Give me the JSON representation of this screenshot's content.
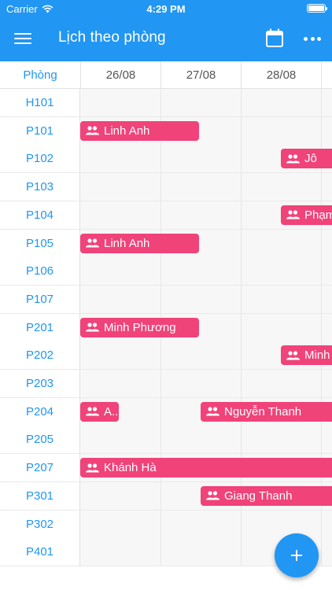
{
  "status_bar": {
    "carrier": "Carrier",
    "time": "4:29 PM"
  },
  "app_bar": {
    "title": "Lịch theo phòng",
    "menu_icon": "hamburger-icon",
    "calendar_icon": "calendar-icon",
    "more_icon": "more-horizontal-icon"
  },
  "table": {
    "room_header": "Phòng",
    "dates": [
      "26/08",
      "27/08",
      "28/08"
    ],
    "rows": [
      {
        "room": "H101",
        "events": []
      },
      {
        "room": "P101",
        "events": [
          {
            "name": "Linh Anh",
            "start_day": 0,
            "span": 1.5
          }
        ]
      },
      {
        "room": "P102",
        "events": [
          {
            "name": "Jô",
            "start_day": 2.5,
            "span": 1
          }
        ]
      },
      {
        "room": "P103",
        "events": []
      },
      {
        "room": "P104",
        "events": [
          {
            "name": "Phạm",
            "start_day": 2.5,
            "span": 1
          }
        ]
      },
      {
        "room": "P105",
        "events": [
          {
            "name": "Linh Anh",
            "start_day": 0,
            "span": 1.5
          }
        ]
      },
      {
        "room": "P106",
        "events": []
      },
      {
        "room": "P107",
        "events": []
      },
      {
        "room": "P201",
        "events": [
          {
            "name": "Minh Phương",
            "start_day": 0,
            "span": 1.5
          }
        ]
      },
      {
        "room": "P202",
        "events": [
          {
            "name": "Minh",
            "start_day": 2.5,
            "span": 1
          }
        ]
      },
      {
        "room": "P203",
        "events": []
      },
      {
        "room": "P204",
        "events": [
          {
            "name": "A...",
            "start_day": 0,
            "span": 0.5
          },
          {
            "name": "Nguyễn Thanh",
            "start_day": 1.5,
            "span": 2
          }
        ]
      },
      {
        "room": "P205",
        "events": []
      },
      {
        "room": "P207",
        "events": [
          {
            "name": "Khánh Hà",
            "start_day": 0,
            "span": 3.5
          }
        ]
      },
      {
        "room": "P301",
        "events": [
          {
            "name": "Giang Thanh",
            "start_day": 1.5,
            "span": 2
          }
        ]
      },
      {
        "room": "P302",
        "events": []
      },
      {
        "room": "P401",
        "events": []
      }
    ]
  },
  "fab": {
    "icon": "plus-icon"
  },
  "colors": {
    "primary": "#2196F3",
    "event": "#F0437A"
  }
}
